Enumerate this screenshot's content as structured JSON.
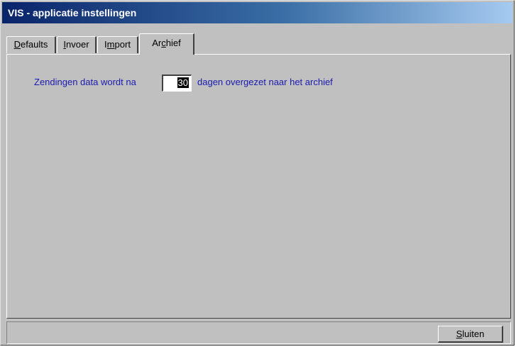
{
  "window": {
    "title": "VIS - applicatie instellingen"
  },
  "tabs": [
    {
      "label": "Defaults",
      "mnemonic_index": 0,
      "active": false
    },
    {
      "label": "Invoer",
      "mnemonic_index": 0,
      "active": false
    },
    {
      "label": "Import",
      "mnemonic_index": 1,
      "active": false
    },
    {
      "label": "Archief",
      "mnemonic_index": 2,
      "active": true
    }
  ],
  "archief": {
    "label_before": "Zendingen data wordt na",
    "days_value": "30",
    "label_after": "dagen overgezet naar het archief"
  },
  "footer": {
    "close_label": "Sluiten"
  },
  "colors": {
    "label_text": "#1a1ab0",
    "dialog_bg": "#c0c0c0",
    "titlebar_start": "#0a246a"
  }
}
